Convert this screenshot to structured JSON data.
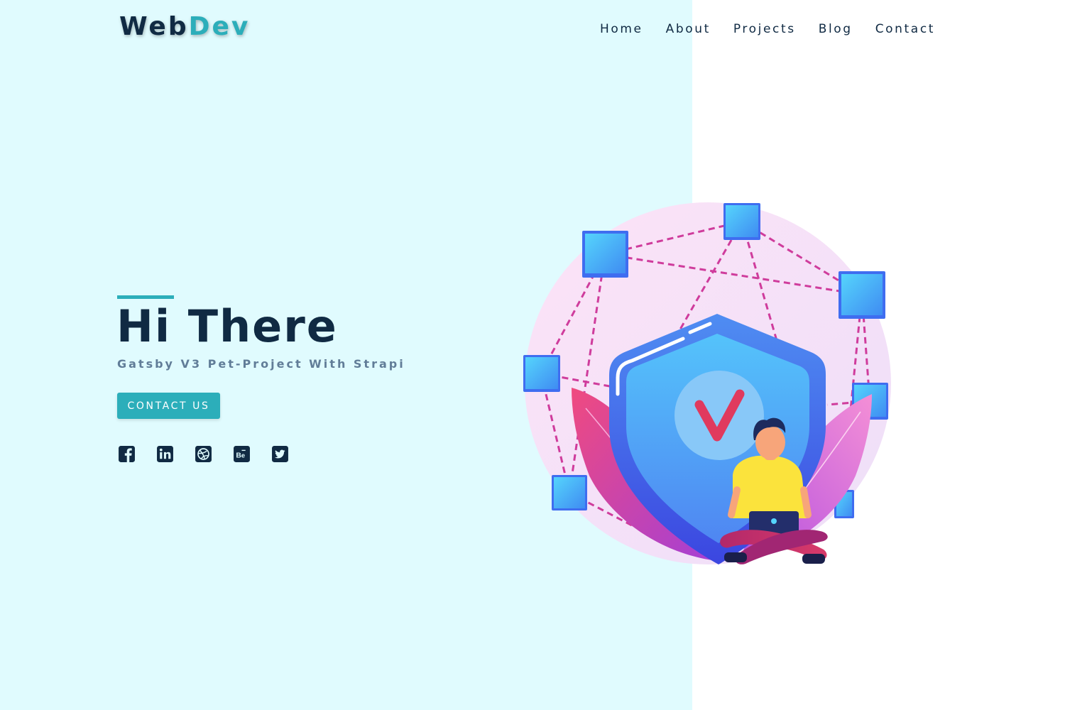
{
  "brand": {
    "part1": "Web",
    "part2": "Dev"
  },
  "nav": {
    "links": [
      "Home",
      "About",
      "Projects",
      "Blog",
      "Contact"
    ]
  },
  "hero": {
    "title": "Hi There",
    "subtitle": "Gatsby V3 Pet-Project With Strapi",
    "cta_label": "CONTACT US"
  },
  "social": {
    "icons": [
      "facebook-icon",
      "linkedin-icon",
      "dribbble-icon",
      "behance-icon",
      "twitter-icon"
    ]
  },
  "colors": {
    "left_bg": "#e0fbfe",
    "right_bg": "#ffffff",
    "accent": "#2caeba",
    "dark": "#102a43",
    "muted": "#617d98",
    "check_mark": "#e03a5e"
  }
}
